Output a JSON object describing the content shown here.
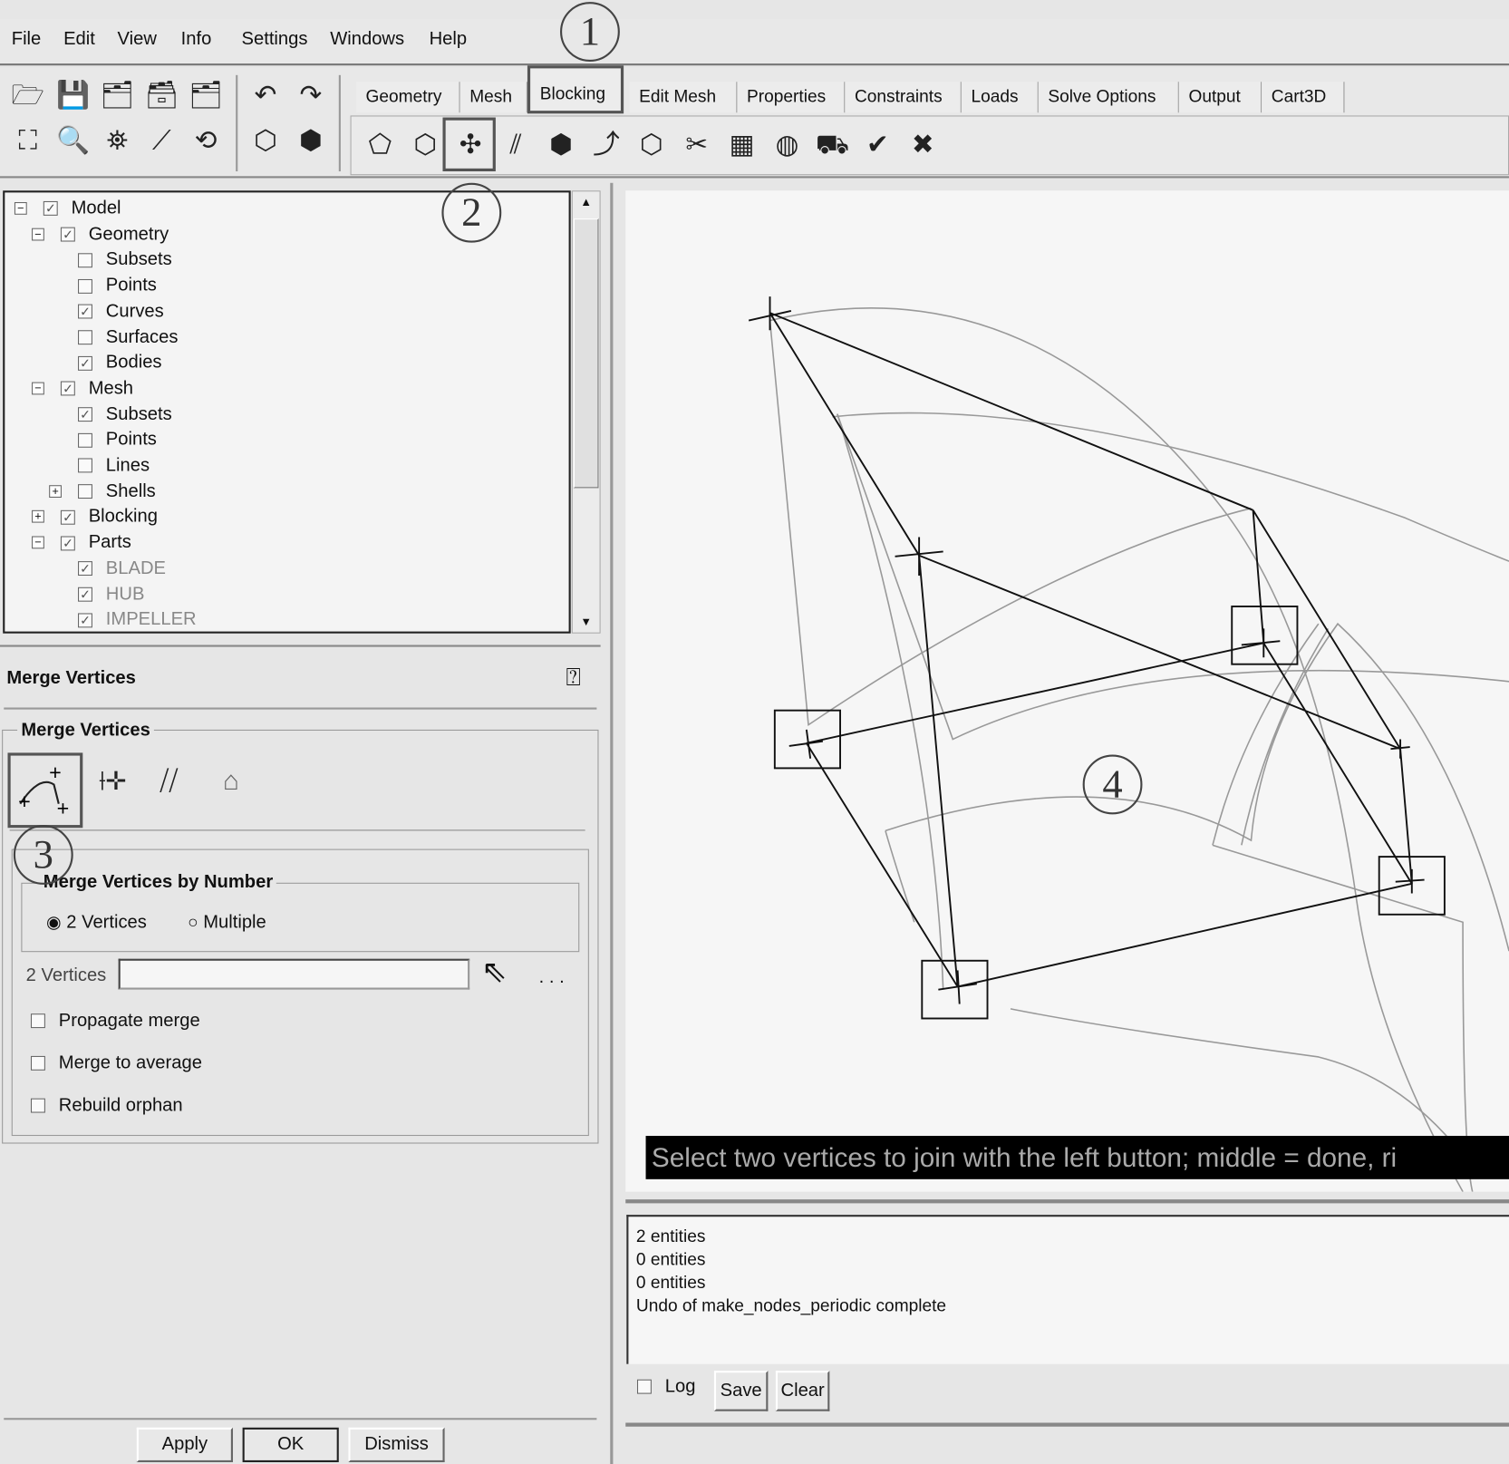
{
  "menu": [
    "File",
    "Edit",
    "View",
    "Info",
    "Settings",
    "Windows",
    "Help"
  ],
  "tabs": [
    "Geometry",
    "Mesh",
    "Blocking",
    "Edit Mesh",
    "Properties",
    "Constraints",
    "Loads",
    "Solve Options",
    "Output",
    "Cart3D"
  ],
  "active_tab": "Blocking",
  "tree": [
    {
      "label": "Model",
      "level": 0,
      "checked": true,
      "expander": "minus"
    },
    {
      "label": "Geometry",
      "level": 1,
      "checked": true,
      "expander": "minus"
    },
    {
      "label": "Subsets",
      "level": 2,
      "checked": false
    },
    {
      "label": "Points",
      "level": 2,
      "checked": false
    },
    {
      "label": "Curves",
      "level": 2,
      "checked": true
    },
    {
      "label": "Surfaces",
      "level": 2,
      "checked": false
    },
    {
      "label": "Bodies",
      "level": 2,
      "checked": true
    },
    {
      "label": "Mesh",
      "level": 1,
      "checked": true,
      "expander": "minus"
    },
    {
      "label": "Subsets",
      "level": 2,
      "checked": true
    },
    {
      "label": "Points",
      "level": 2,
      "checked": false
    },
    {
      "label": "Lines",
      "level": 2,
      "checked": false
    },
    {
      "label": "Shells",
      "level": 2,
      "checked": false,
      "expander": "plus"
    },
    {
      "label": "Blocking",
      "level": 1,
      "checked": true,
      "expander": "plus"
    },
    {
      "label": "Parts",
      "level": 1,
      "checked": true,
      "expander": "minus"
    },
    {
      "label": "BLADE",
      "level": 2,
      "checked": true,
      "gray": true
    },
    {
      "label": "HUB",
      "level": 2,
      "checked": true,
      "gray": true
    },
    {
      "label": "IMPELLER",
      "level": 2,
      "checked": true,
      "gray": true
    }
  ],
  "form": {
    "title": "Merge Vertices",
    "group": "Merge Vertices",
    "subgroup": "Merge Vertices by Number",
    "radio_2": "2 Vertices",
    "radio_multi": "Multiple",
    "selected": "2 Vertices",
    "field_label": "2 Vertices",
    "field_value": "",
    "more": ". . .",
    "checks": [
      "Propagate merge",
      "Merge to average",
      "Rebuild orphan"
    ],
    "apply": "Apply",
    "ok": "OK",
    "dismiss": "Dismiss"
  },
  "viewport": {
    "message": "Select two vertices to join with the left button; middle = done, ri"
  },
  "log": {
    "lines": [
      "2 entities",
      "0 entities",
      "0 entities",
      "Undo of make_nodes_periodic complete"
    ],
    "log_label": "Log",
    "save": "Save",
    "clear": "Clear"
  },
  "callouts": [
    "1",
    "2",
    "3",
    "4"
  ]
}
